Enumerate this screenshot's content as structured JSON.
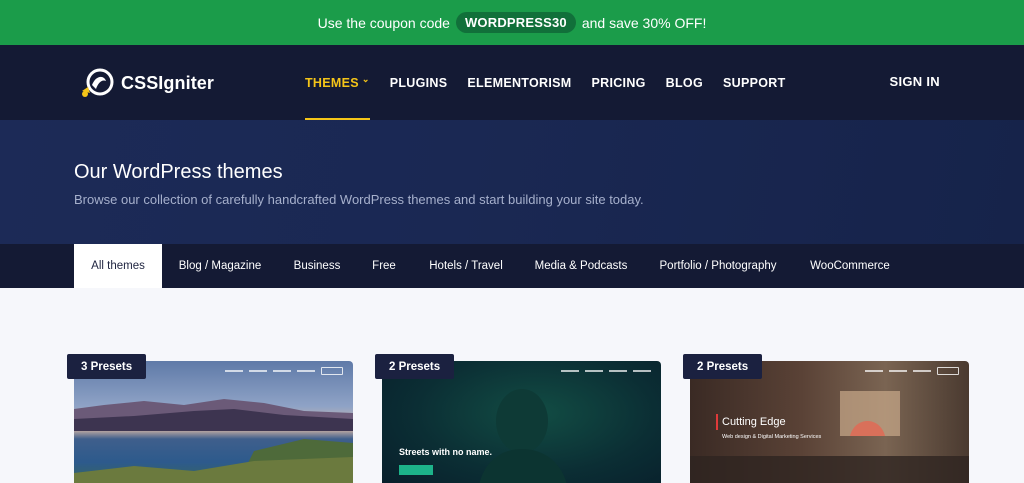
{
  "promo": {
    "text_before": "Use the coupon code",
    "coupon": "WORDPRESS30",
    "text_after": "and save 30% OFF!"
  },
  "header": {
    "logo_text": "CSSIgniter",
    "nav": [
      {
        "label": "THEMES",
        "active": true,
        "has_dropdown": true
      },
      {
        "label": "PLUGINS"
      },
      {
        "label": "ELEMENTORISM"
      },
      {
        "label": "PRICING"
      },
      {
        "label": "BLOG"
      },
      {
        "label": "SUPPORT"
      }
    ],
    "sign_in": "SIGN IN"
  },
  "hero": {
    "title": "Our WordPress themes",
    "subtitle": "Browse our collection of carefully handcrafted WordPress themes and start building your site today."
  },
  "tabs": [
    {
      "label": "All themes",
      "active": true
    },
    {
      "label": "Blog / Magazine"
    },
    {
      "label": "Business"
    },
    {
      "label": "Free"
    },
    {
      "label": "Hotels / Travel"
    },
    {
      "label": "Media & Podcasts"
    },
    {
      "label": "Portfolio / Photography"
    },
    {
      "label": "WooCommerce"
    }
  ],
  "cards": [
    {
      "badge": "3 Presets"
    },
    {
      "badge": "2 Presets",
      "headline": "Streets with no name."
    },
    {
      "badge": "2 Presets",
      "headline": "Cutting Edge",
      "subline": "Web design & Digital Marketing Services"
    }
  ],
  "colors": {
    "promo_bg": "#1b9c4a",
    "header_bg": "#141a34",
    "accent": "#f5c518"
  }
}
